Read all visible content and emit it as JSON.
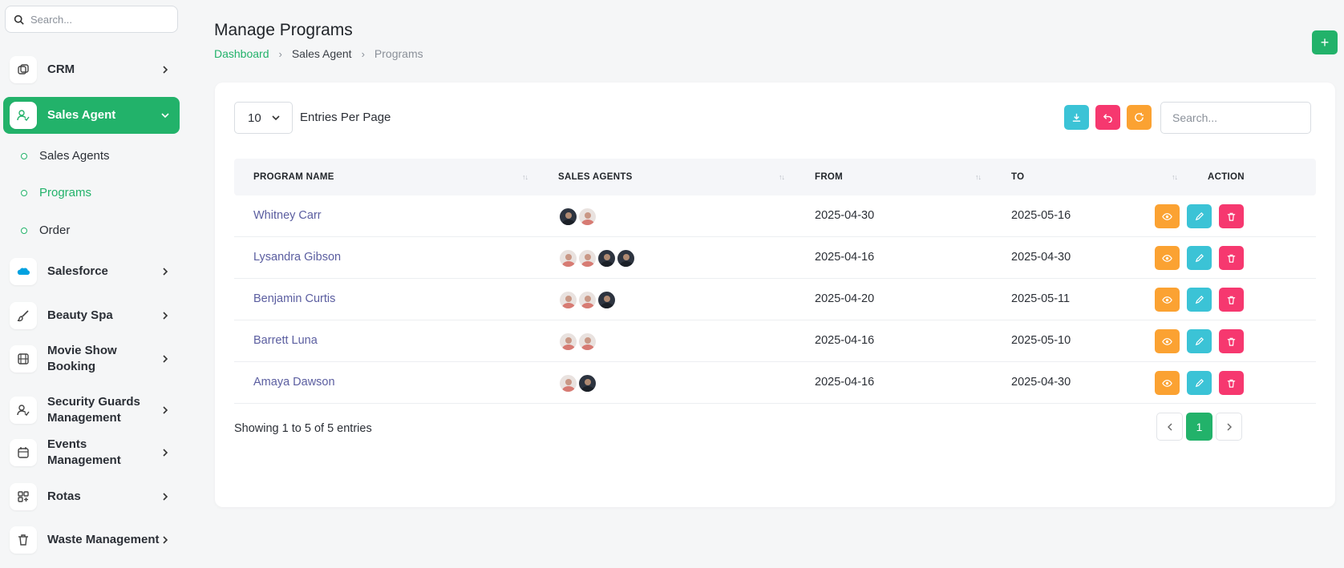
{
  "colors": {
    "accent": "#22b26a",
    "info": "#3bc3d6",
    "danger": "#f6386f",
    "warning": "#fba232",
    "link": "#5b5ea0"
  },
  "sidebar": {
    "search_placeholder": "Search...",
    "items": [
      {
        "label": "CRM",
        "icon": "crm-icon"
      },
      {
        "label": "Sales Agent",
        "icon": "user-check-icon",
        "active": true,
        "subitems": [
          {
            "label": "Sales Agents"
          },
          {
            "label": "Programs",
            "active": true
          },
          {
            "label": "Order"
          }
        ]
      },
      {
        "label": "Salesforce",
        "icon": "salesforce-logo-icon"
      },
      {
        "label": "Beauty Spa",
        "icon": "brush-icon"
      },
      {
        "label": "Movie Show Booking",
        "icon": "film-icon"
      },
      {
        "label": "Security Guards Management",
        "icon": "user-check-icon"
      },
      {
        "label": "Events Management",
        "icon": "calendar-icon"
      },
      {
        "label": "Rotas",
        "icon": "grid-plus-icon"
      },
      {
        "label": "Waste Management",
        "icon": "trash-icon"
      }
    ]
  },
  "header": {
    "title": "Manage Programs",
    "breadcrumb": [
      "Dashboard",
      "Sales Agent",
      "Programs"
    ],
    "add_label": "+"
  },
  "toolbar": {
    "per_page_value": "10",
    "per_page_label": "Entries Per Page",
    "search_placeholder": "Search..."
  },
  "table": {
    "columns": [
      "PROGRAM NAME",
      "SALES AGENTS",
      "FROM",
      "TO",
      "ACTION"
    ],
    "rows": [
      {
        "name": "Whitney Carr",
        "agents": [
          "dark",
          "light"
        ],
        "from": "2025-04-30",
        "to": "2025-05-16"
      },
      {
        "name": "Lysandra Gibson",
        "agents": [
          "light",
          "light",
          "dark",
          "dark"
        ],
        "from": "2025-04-16",
        "to": "2025-04-30"
      },
      {
        "name": "Benjamin Curtis",
        "agents": [
          "light",
          "light",
          "dark"
        ],
        "from": "2025-04-20",
        "to": "2025-05-11"
      },
      {
        "name": "Barrett Luna",
        "agents": [
          "light",
          "light"
        ],
        "from": "2025-04-16",
        "to": "2025-05-10"
      },
      {
        "name": "Amaya Dawson",
        "agents": [
          "light",
          "dark"
        ],
        "from": "2025-04-16",
        "to": "2025-04-30"
      }
    ]
  },
  "footer": {
    "showing": "Showing 1 to 5 of 5 entries",
    "current_page": "1"
  }
}
